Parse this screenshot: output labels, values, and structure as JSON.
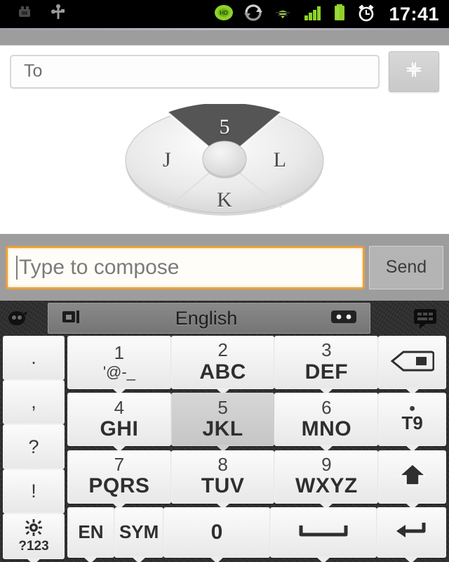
{
  "statusbar": {
    "time": "17:41",
    "icons_left": [
      "usb-debug-icon",
      "usb-icon"
    ],
    "icons_right": [
      "data-connection-icon",
      "sync-icon",
      "wifi-icon",
      "signal-icon",
      "battery-icon",
      "alarm-icon"
    ]
  },
  "recipient": {
    "placeholder": "To",
    "add_contact_label": "+"
  },
  "radial_menu": {
    "top": "5",
    "left": "J",
    "right": "L",
    "bottom": "K",
    "highlight_color": "#555555",
    "base_color": "#e2e2e2"
  },
  "compose": {
    "placeholder": "Type to compose",
    "send_label": "Send",
    "focus_color": "#e8a13a"
  },
  "keyboard": {
    "toolbar": {
      "language": "English",
      "left_icon": "settings-circle-icon",
      "strip_left_icon": "keyboard-mode-icon",
      "strip_right_icon": "emoticon-icon",
      "right_icon": "voice-input-icon"
    },
    "punctuation_keys": [
      {
        "name": "period",
        "label": "."
      },
      {
        "name": "comma",
        "label": ","
      },
      {
        "name": "question",
        "label": "?"
      },
      {
        "name": "exclamation",
        "label": "!"
      }
    ],
    "rows": [
      [
        {
          "name": "key-1",
          "num": "1",
          "sub": "'@-_",
          "sub_kind": "symbols"
        },
        {
          "name": "key-2",
          "num": "2",
          "sub": "ABC",
          "sub_kind": "letters"
        },
        {
          "name": "key-3",
          "num": "3",
          "sub": "DEF",
          "sub_kind": "letters"
        }
      ],
      [
        {
          "name": "key-4",
          "num": "4",
          "sub": "GHI",
          "sub_kind": "letters"
        },
        {
          "name": "key-5",
          "num": "5",
          "sub": "JKL",
          "sub_kind": "letters",
          "pressed": true
        },
        {
          "name": "key-6",
          "num": "6",
          "sub": "MNO",
          "sub_kind": "letters"
        }
      ],
      [
        {
          "name": "key-7",
          "num": "7",
          "sub": "PQRS",
          "sub_kind": "letters"
        },
        {
          "name": "key-8",
          "num": "8",
          "sub": "TUV",
          "sub_kind": "letters"
        },
        {
          "name": "key-9",
          "num": "9",
          "sub": "WXYZ",
          "sub_kind": "letters"
        }
      ]
    ],
    "side_keys": [
      {
        "name": "backspace",
        "icon": "backspace-icon",
        "label": ""
      },
      {
        "name": "t9",
        "icon": "dot-icon",
        "label": "T9"
      },
      {
        "name": "shift",
        "icon": "shift-up-arrow-icon",
        "label": ""
      }
    ],
    "bottom_row": {
      "settings_label": "?123",
      "settings_icon": "gear-icon",
      "lang_label": "EN",
      "sym_label": "SYM",
      "zero_label": "0",
      "space_icon": "space-bar-icon",
      "enter_icon": "enter-arrow-icon"
    }
  }
}
